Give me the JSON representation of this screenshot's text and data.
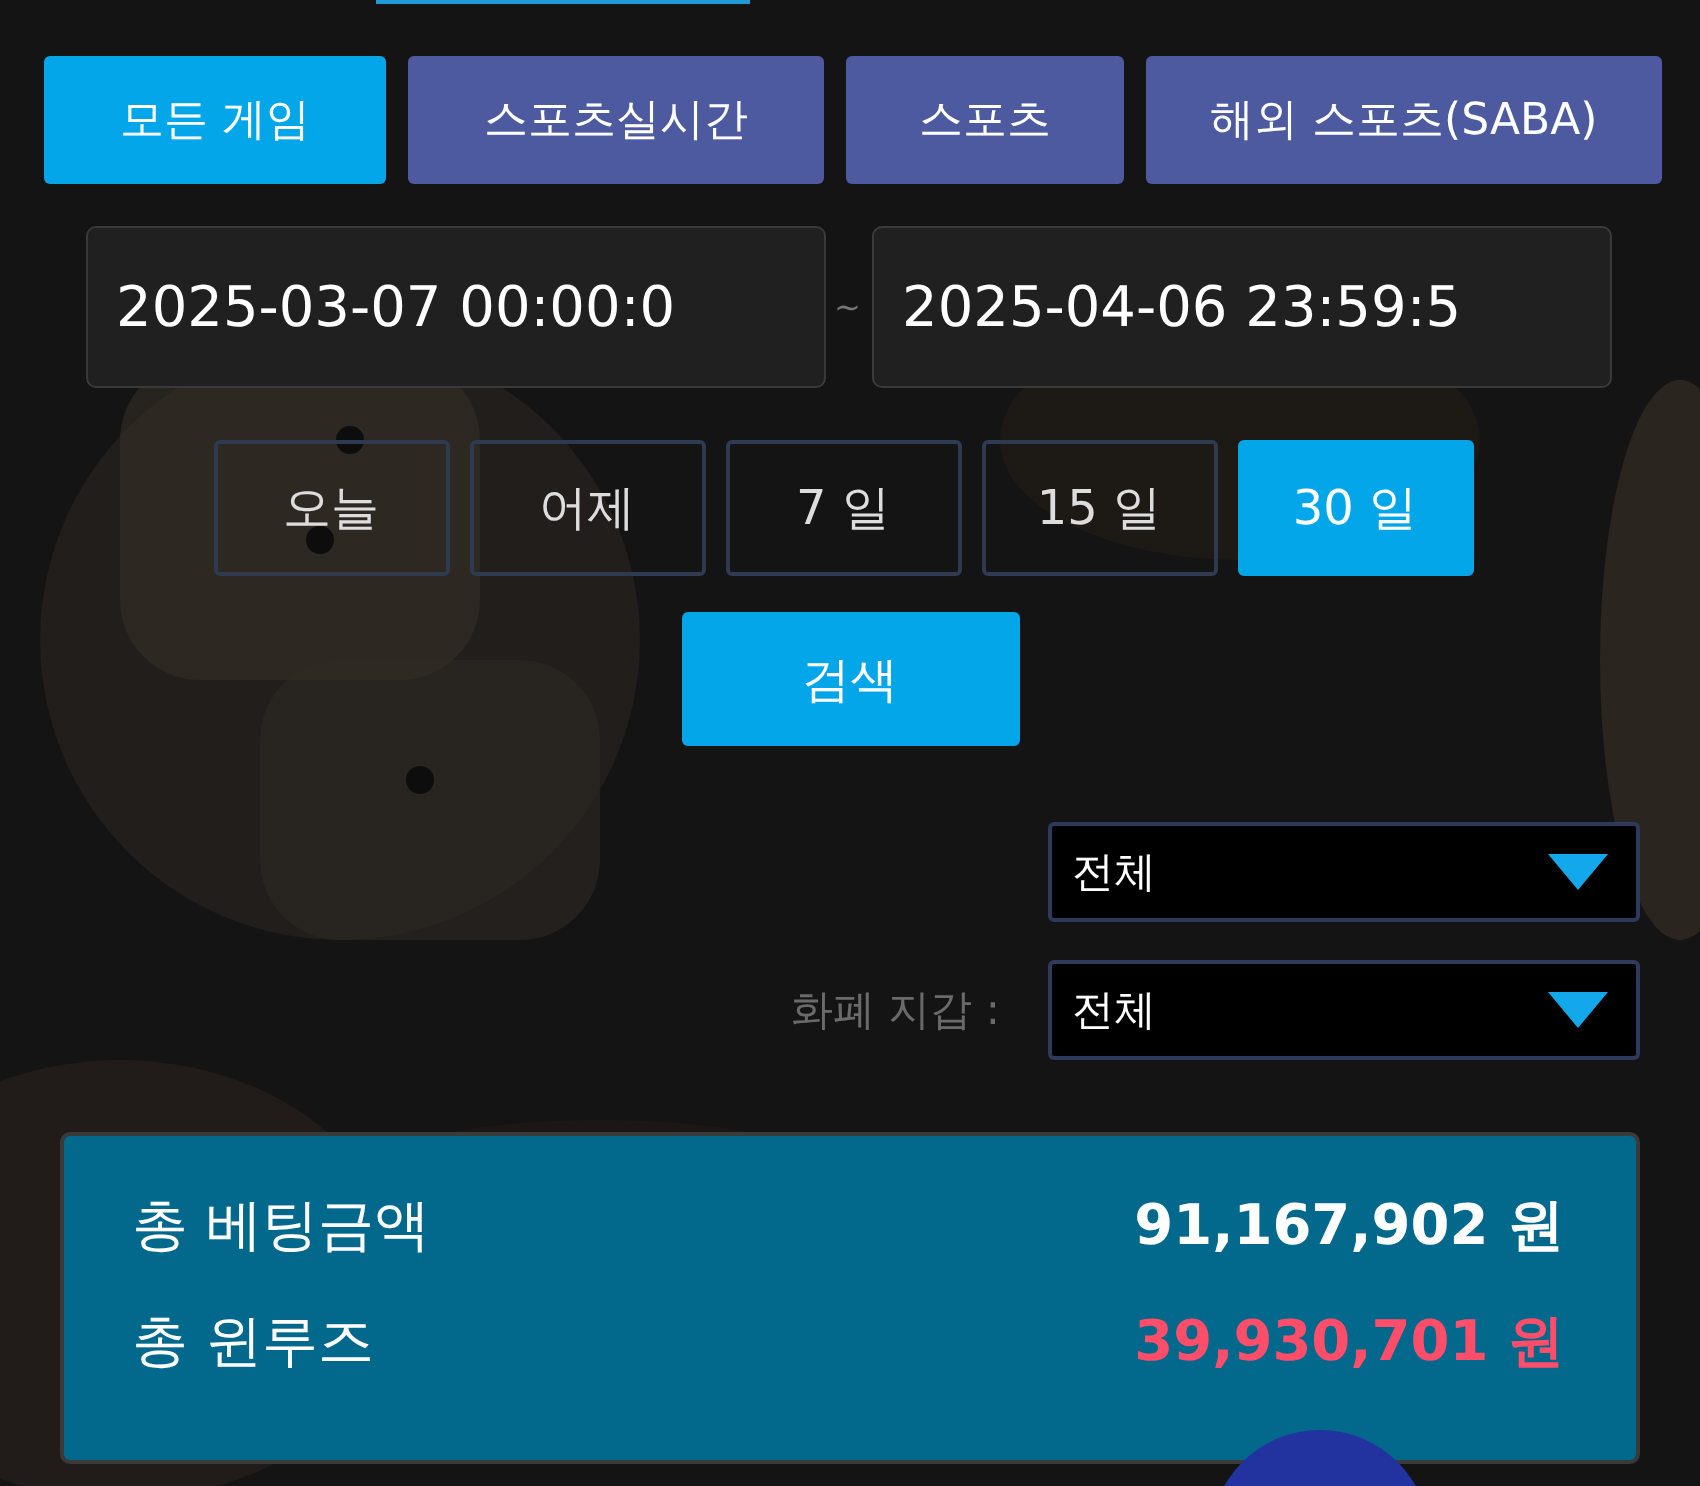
{
  "tabs": [
    {
      "label": "모든 게임",
      "selected": true
    },
    {
      "label": "스포츠실시간",
      "selected": false
    },
    {
      "label": "스포츠",
      "selected": false
    },
    {
      "label": "해외 스포츠(SABA)",
      "selected": false
    }
  ],
  "date_range": {
    "start": "2025-03-07 00:00:0",
    "separator": "~",
    "end": "2025-04-06 23:59:5"
  },
  "quick_ranges": [
    {
      "label": "오늘",
      "selected": false
    },
    {
      "label": "어제",
      "selected": false
    },
    {
      "label": "7 일",
      "selected": false
    },
    {
      "label": "15 일",
      "selected": false
    },
    {
      "label": "30 일",
      "selected": true
    }
  ],
  "search_button": "검색",
  "filters": [
    {
      "value": "전체"
    },
    {
      "label": "화폐 지갑 :",
      "value": "전체"
    }
  ],
  "summary": [
    {
      "label": "총 베팅금액",
      "value": "91,167,902 원",
      "kind": "normal"
    },
    {
      "label": "총 윈루즈",
      "value": "39,930,701 원",
      "kind": "loss"
    }
  ]
}
